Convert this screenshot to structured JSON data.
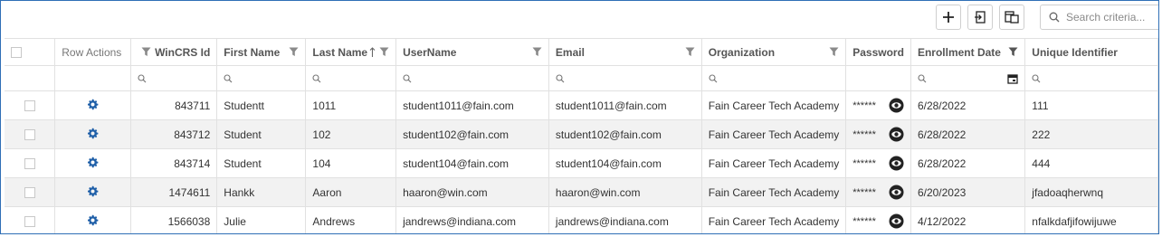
{
  "toolbar": {
    "add_icon": "plus-icon",
    "export_icon": "export-icon",
    "columns_icon": "columns-icon",
    "search_placeholder": "Search criteria..."
  },
  "columns": {
    "row_actions": "Row Actions",
    "wincrs_id": "WinCRS Id",
    "first_name": "First Name",
    "last_name": "Last Name",
    "username": "UserName",
    "email": "Email",
    "organization": "Organization",
    "password": "Password",
    "enrollment_date": "Enrollment Date",
    "unique_identifier": "Unique Identifier"
  },
  "rows": [
    {
      "id": "843711",
      "first": "Studentt",
      "last": "1011",
      "username": "student1011@fain.com",
      "email": "student1011@fain.com",
      "org": "Fain Career Tech Academy",
      "password": "******",
      "date": "6/28/2022",
      "uid": "111"
    },
    {
      "id": "843712",
      "first": "Student",
      "last": "102",
      "username": "student102@fain.com",
      "email": "student102@fain.com",
      "org": "Fain Career Tech Academy",
      "password": "******",
      "date": "6/28/2022",
      "uid": "222"
    },
    {
      "id": "843714",
      "first": "Student",
      "last": "104",
      "username": "student104@fain.com",
      "email": "student104@fain.com",
      "org": "Fain Career Tech Academy",
      "password": "******",
      "date": "6/28/2022",
      "uid": "444"
    },
    {
      "id": "1474611",
      "first": "Hankk",
      "last": "Aaron",
      "username": "haaron@win.com",
      "email": "haaron@win.com",
      "org": "Fain Career Tech Academy",
      "password": "******",
      "date": "6/20/2023",
      "uid": "jfadoaqherwnq"
    },
    {
      "id": "1566038",
      "first": "Julie",
      "last": "Andrews",
      "username": "jandrews@indiana.com",
      "email": "jandrews@indiana.com",
      "org": "Fain Career Tech Academy",
      "password": "******",
      "date": "4/12/2022",
      "uid": "nfalkdafjifowijuwe"
    }
  ],
  "colors": {
    "gear": "#1f5fa8",
    "border": "#2f6fb6",
    "stripe": "#f2f2f2"
  }
}
